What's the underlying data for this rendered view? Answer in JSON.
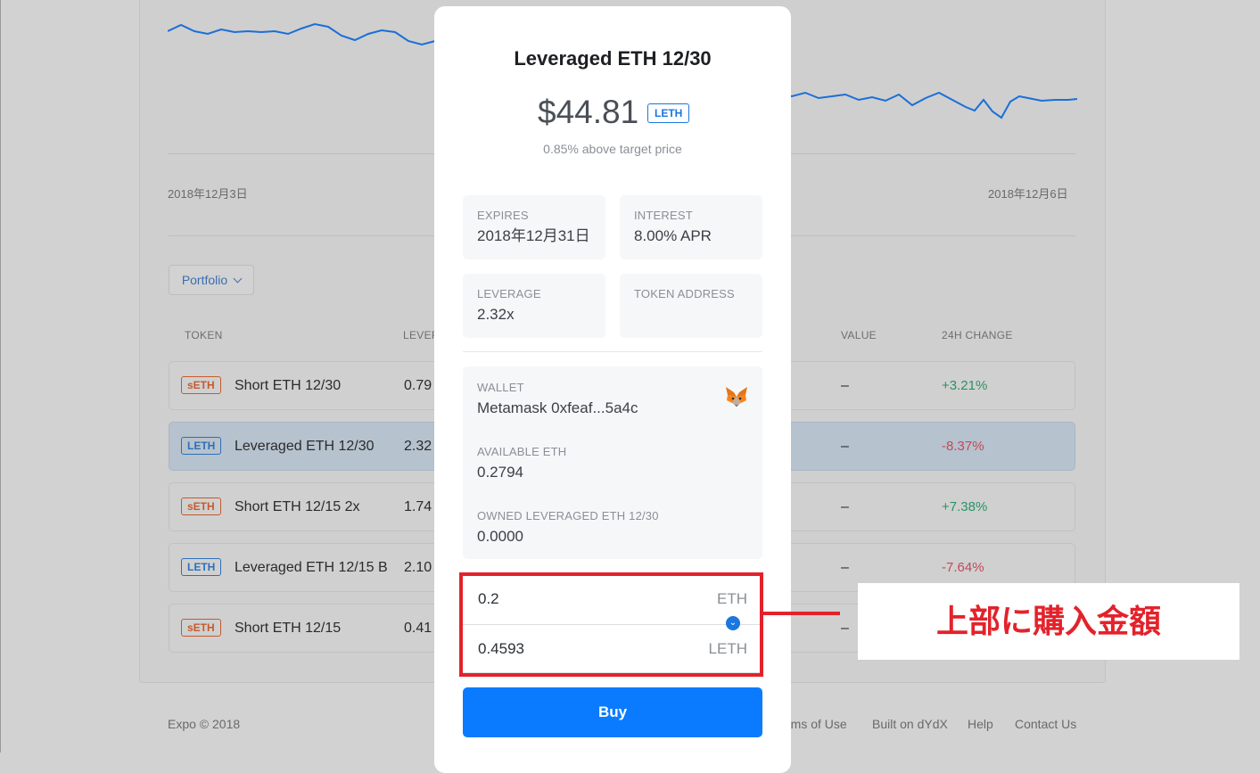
{
  "chart": {
    "start_date": "2018年12月3日",
    "end_date": "2018年12月6日",
    "line_color": "#1a73e8"
  },
  "portfolio": {
    "button_label": "Portfolio",
    "columns": [
      "TOKEN",
      "LEVER",
      "VALUE",
      "24H CHANGE"
    ],
    "rows": [
      {
        "badge": "sETH",
        "name": "Short ETH 12/30",
        "leverage": "0.79",
        "value": "–",
        "change": "+3.21%"
      },
      {
        "badge": "LETH",
        "name": "Leveraged ETH 12/30",
        "leverage": "2.32",
        "value": "–",
        "change": "-8.37%"
      },
      {
        "badge": "sETH",
        "name": "Short ETH 12/15 2x",
        "leverage": "1.74",
        "value": "–",
        "change": "+7.38%"
      },
      {
        "badge": "LETH",
        "name": "Leveraged ETH 12/15 B",
        "leverage": "2.10",
        "value": "–",
        "change": "-7.64%"
      },
      {
        "badge": "sETH",
        "name": "Short ETH 12/15",
        "leverage": "0.41",
        "value": "–",
        "change": ""
      }
    ]
  },
  "footer": {
    "copyright": "Expo © 2018",
    "links": [
      "rms of Use",
      "Built on dYdX",
      "Help",
      "Contact Us"
    ]
  },
  "modal": {
    "title": "Leveraged ETH 12/30",
    "price": "$44.81",
    "token_badge": "LETH",
    "subtitle": "0.85% above target price",
    "expires_label": "EXPIRES",
    "expires_value": "2018年12月31日",
    "interest_label": "INTEREST",
    "interest_value": "8.00% APR",
    "leverage_label": "LEVERAGE",
    "leverage_value": "2.32x",
    "token_address_label": "TOKEN ADDRESS",
    "wallet_label": "WALLET",
    "wallet_value": "Metamask 0xfeaf...5a4c",
    "available_label": "AVAILABLE ETH",
    "available_value": "0.2794",
    "owned_label": "OWNED LEVERAGED ETH 12/30",
    "owned_value": "0.0000",
    "pay_amount": "0.2",
    "pay_unit": "ETH",
    "receive_amount": "0.4593",
    "receive_unit": "LETH",
    "buy_label": "Buy"
  },
  "annotation": {
    "callout_text": "上部に購入金額",
    "color": "#e3222b"
  }
}
